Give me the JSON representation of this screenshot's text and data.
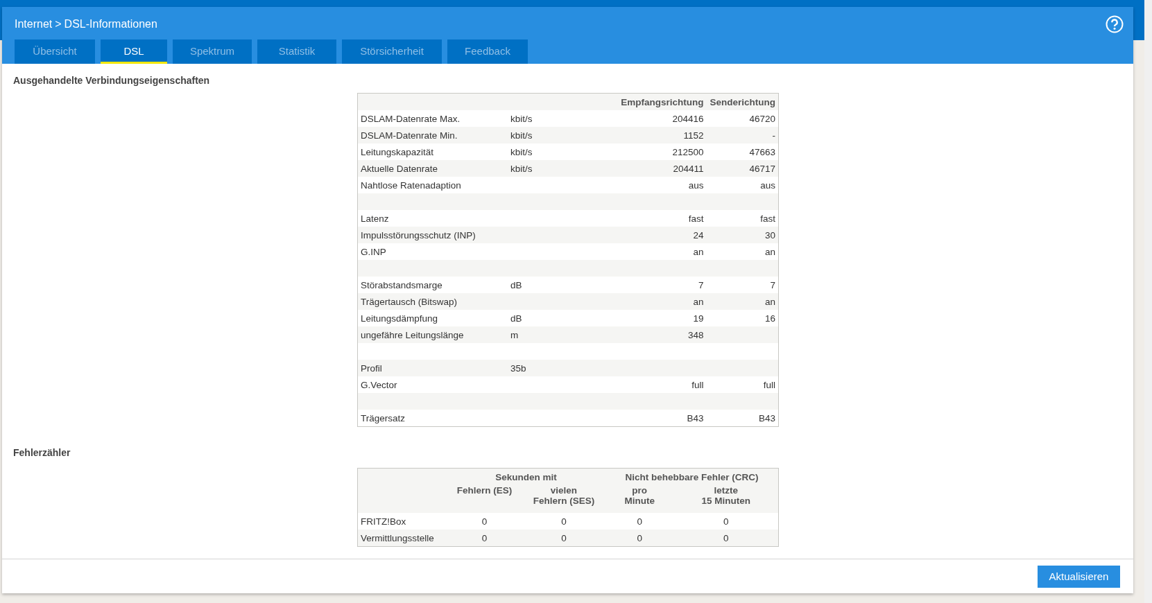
{
  "breadcrumb": {
    "parent": "Internet",
    "separator": ">",
    "current": "DSL-Informationen"
  },
  "tabs": [
    {
      "label": "Übersicht",
      "selected": false
    },
    {
      "label": "DSL",
      "selected": true
    },
    {
      "label": "Spektrum",
      "selected": false
    },
    {
      "label": "Statistik",
      "selected": false
    },
    {
      "label": "Störsicherheit",
      "selected": false
    },
    {
      "label": "Feedback",
      "selected": false
    }
  ],
  "connection": {
    "title": "Ausgehandelte Verbindungseigenschaften",
    "columns": {
      "receive": "Empfangsrichtung",
      "send": "Senderichtung"
    },
    "rows": [
      {
        "kind": "data",
        "label": "DSLAM-Datenrate Max.",
        "unit": "kbit/s",
        "receive": "204416",
        "send": "46720"
      },
      {
        "kind": "data",
        "label": "DSLAM-Datenrate Min.",
        "unit": "kbit/s",
        "receive": "1152",
        "send": "-"
      },
      {
        "kind": "data",
        "label": "Leitungskapazität",
        "unit": "kbit/s",
        "receive": "212500",
        "send": "47663"
      },
      {
        "kind": "data",
        "label": "Aktuelle Datenrate",
        "unit": "kbit/s",
        "receive": "204411",
        "send": "46717"
      },
      {
        "kind": "data",
        "label": "Nahtlose Ratenadaption",
        "receive": "aus",
        "send": "aus"
      },
      {
        "kind": "spacer"
      },
      {
        "kind": "data",
        "label": "Latenz",
        "receive": "fast",
        "send": "fast"
      },
      {
        "kind": "data",
        "label": "Impulsstörungsschutz (INP)",
        "receive": "24",
        "send": "30"
      },
      {
        "kind": "data",
        "label": "G.INP",
        "receive": "an",
        "send": "an"
      },
      {
        "kind": "spacer"
      },
      {
        "kind": "data",
        "label": "Störabstandsmarge",
        "unit": "dB",
        "receive": "7",
        "send": "7"
      },
      {
        "kind": "data",
        "label": "Trägertausch (Bitswap)",
        "receive": "an",
        "send": "an"
      },
      {
        "kind": "data",
        "label": "Leitungsdämpfung",
        "unit": "dB",
        "receive": "19",
        "send": "16"
      },
      {
        "kind": "data",
        "label": "ungefähre Leitungslänge",
        "unit": "m",
        "receive": "348"
      },
      {
        "kind": "spacer"
      },
      {
        "kind": "data",
        "label": "Profil",
        "unit": "35b"
      },
      {
        "kind": "data",
        "label": "G.Vector",
        "receive": "full",
        "send": "full"
      },
      {
        "kind": "spacer"
      },
      {
        "kind": "data",
        "label": "Trägersatz",
        "receive": "B43",
        "send": "B43"
      }
    ]
  },
  "errors": {
    "title": "Fehlerzähler",
    "groups": [
      "Sekunden mit",
      "Nicht behebbare Fehler (CRC)"
    ],
    "columns": [
      [
        "Fehlern (ES)"
      ],
      [
        "vielen",
        "Fehlern (SES)"
      ],
      [
        "pro",
        "Minute"
      ],
      [
        "letzte",
        "15 Minuten"
      ]
    ],
    "rows": [
      {
        "label": "FRITZ!Box",
        "values": [
          "0",
          "0",
          "0",
          "0"
        ]
      },
      {
        "label": "Vermittlungsstelle",
        "values": [
          "0",
          "0",
          "0",
          "0"
        ]
      }
    ]
  },
  "footer": {
    "button": "Aktualisieren"
  }
}
